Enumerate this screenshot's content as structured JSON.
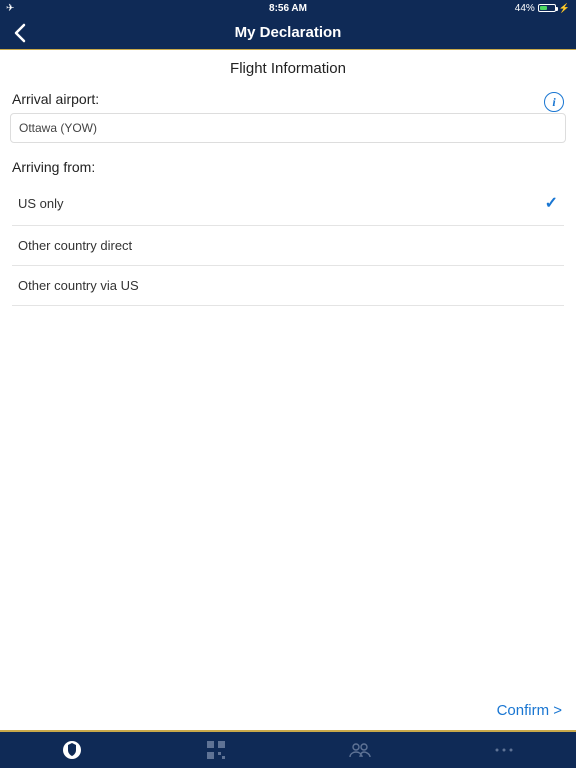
{
  "status": {
    "time": "8:56 AM",
    "battery_pct": "44%"
  },
  "nav": {
    "title": "My Declaration"
  },
  "page": {
    "section_title": "Flight Information",
    "arrival_label": "Arrival airport:",
    "arrival_value": "Ottawa (YOW)",
    "arriving_from_label": "Arriving from:",
    "options": {
      "0": {
        "label": "US only",
        "selected": true
      },
      "1": {
        "label": "Other country direct",
        "selected": false
      },
      "2": {
        "label": "Other country via US",
        "selected": false
      }
    },
    "confirm": "Confirm >"
  }
}
